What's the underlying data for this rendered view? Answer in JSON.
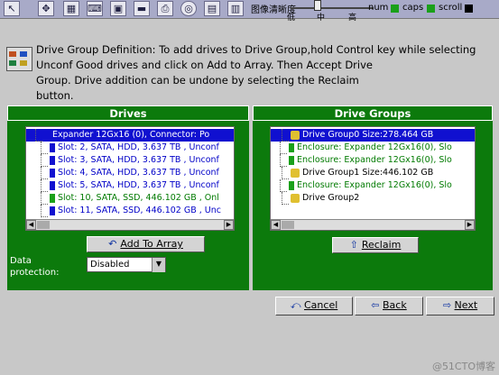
{
  "toolbar": {
    "icons": [
      "cursor-icon",
      "move-icon",
      "display-icon",
      "keyboard-icon",
      "monitor-icon",
      "save-icon",
      "print-icon",
      "refresh-icon",
      "settings-icon",
      "capture-icon"
    ],
    "quality_label": "图像清晰度",
    "ticks": {
      "low": "低",
      "mid": "中",
      "high": "高"
    },
    "num_label": "num",
    "caps_label": "caps",
    "scroll_label": "scroll",
    "num_color": "#1aa01a",
    "caps_color": "#1aa01a",
    "scroll_color": "#000000"
  },
  "definition": {
    "line1": "Drive Group Definition:  To add drives to Drive Group,hold Control key while selecting",
    "line2": "Unconf Good drives and click on Add to Array. Then Accept Drive",
    "line3": "Group. Drive addition can be undone by selecting the Reclaim",
    "line4": "button."
  },
  "drives": {
    "title": "Drives",
    "items": [
      {
        "label": "Expander 12Gx16 (0), Connector: Po",
        "selected": true,
        "color": "#ffffff"
      },
      {
        "label": "Slot: 2, SATA, HDD, 3.637 TB , Unconf",
        "selected": false,
        "color": "#0000c8"
      },
      {
        "label": "Slot: 3, SATA, HDD, 3.637 TB , Unconf",
        "selected": false,
        "color": "#0000c8"
      },
      {
        "label": "Slot: 4, SATA, HDD, 3.637 TB , Unconf",
        "selected": false,
        "color": "#0000c8"
      },
      {
        "label": "Slot: 5, SATA, HDD, 3.637 TB , Unconf",
        "selected": false,
        "color": "#0000c8"
      },
      {
        "label": "Slot: 10, SATA, SSD, 446.102 GB , Onl",
        "selected": false,
        "color": "#007a00"
      },
      {
        "label": "Slot: 11, SATA, SSD, 446.102 GB , Unc",
        "selected": false,
        "color": "#0000c8"
      }
    ],
    "add_button": "Add To Array",
    "protection_label": "Data protection:",
    "protection_label_1": "Data",
    "protection_label_2": "protection:",
    "protection_value": "Disabled"
  },
  "drive_groups": {
    "title": "Drive Groups",
    "items": [
      {
        "label": "Drive Group0  Size:278.464 GB",
        "selected": true,
        "color": "#ffffff"
      },
      {
        "label": "Enclosure: Expander 12Gx16(0), Slo",
        "selected": false,
        "color": "#007a00"
      },
      {
        "label": "Enclosure: Expander 12Gx16(0), Slo",
        "selected": false,
        "color": "#007a00"
      },
      {
        "label": "Drive Group1  Size:446.102 GB",
        "selected": false,
        "color": "#000000"
      },
      {
        "label": "Enclosure: Expander 12Gx16(0), Slo",
        "selected": false,
        "color": "#007a00"
      },
      {
        "label": "Drive Group2",
        "selected": false,
        "color": "#000000"
      }
    ],
    "reclaim_button": "Reclaim"
  },
  "nav": {
    "cancel": "Cancel",
    "back": "Back",
    "next": "Next"
  },
  "watermark": "@51CTO博客"
}
